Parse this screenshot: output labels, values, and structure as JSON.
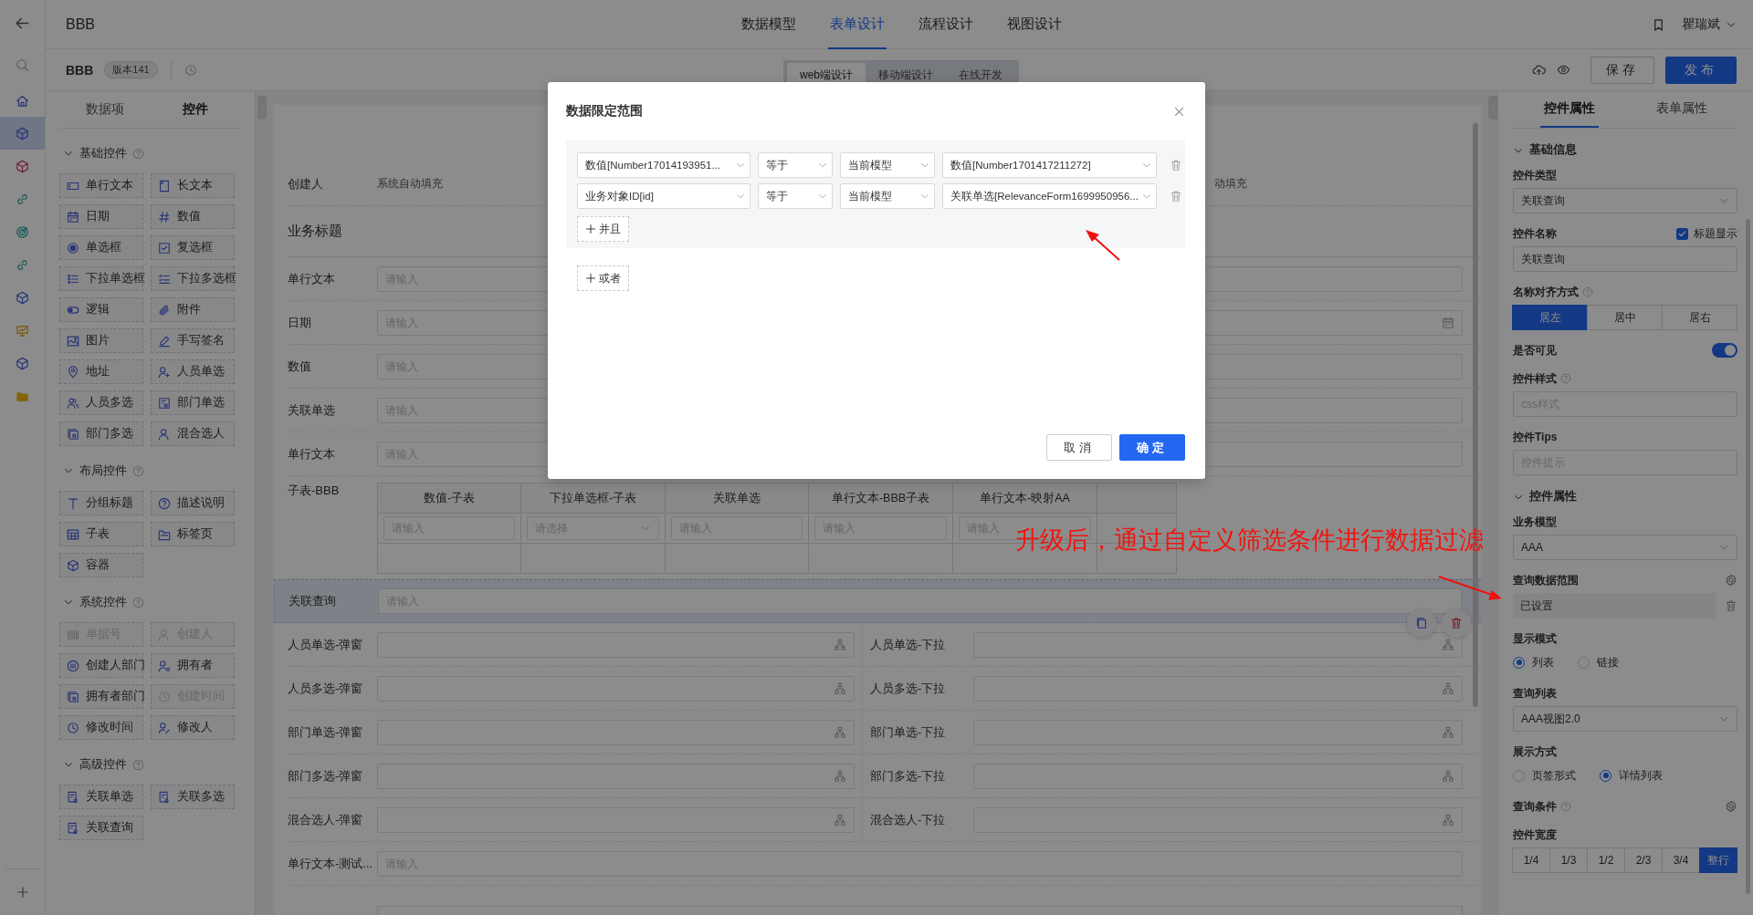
{
  "nav": {
    "items": [
      {
        "selected": false
      },
      {
        "selected": true
      },
      {
        "selected": false
      },
      {
        "selected": false
      },
      {
        "selected": false
      },
      {
        "selected": false
      },
      {
        "selected": false
      },
      {
        "selected": false
      },
      {
        "selected": false
      },
      {
        "selected": false
      }
    ]
  },
  "header": {
    "app_title": "BBB",
    "tabs": [
      {
        "label": "数据模型",
        "selected": false
      },
      {
        "label": "表单设计",
        "selected": true
      },
      {
        "label": "流程设计",
        "selected": false
      },
      {
        "label": "视图设计",
        "selected": false
      }
    ],
    "user": "瞿瑞斌"
  },
  "toolbar": {
    "form_name": "BBB",
    "version": "版本141",
    "modes": [
      {
        "label": "web端设计",
        "selected": true
      },
      {
        "label": "移动端设计",
        "selected": false
      },
      {
        "label": "在线开发",
        "selected": false
      }
    ],
    "buttons": [
      {
        "label": "保存",
        "kind": "default"
      },
      {
        "label": "发布",
        "kind": "primary"
      }
    ]
  },
  "palette": {
    "tabs": [
      {
        "label": "数据项",
        "selected": false
      },
      {
        "label": "控件",
        "selected": true
      }
    ],
    "groups": [
      {
        "title": "基础控件",
        "expanded": true,
        "items": [
          {
            "label": "单行文本",
            "disabled": false
          },
          {
            "label": "长文本",
            "disabled": false
          },
          {
            "label": "日期",
            "disabled": false
          },
          {
            "label": "数值",
            "disabled": false
          },
          {
            "label": "单选框",
            "disabled": false
          },
          {
            "label": "复选框",
            "disabled": false
          },
          {
            "label": "下拉单选框",
            "disabled": false
          },
          {
            "label": "下拉多选框",
            "disabled": false
          },
          {
            "label": "逻辑",
            "disabled": false
          },
          {
            "label": "附件",
            "disabled": false
          },
          {
            "label": "图片",
            "disabled": false
          },
          {
            "label": "手写签名",
            "disabled": false
          },
          {
            "label": "地址",
            "disabled": false
          },
          {
            "label": "人员单选",
            "disabled": false
          },
          {
            "label": "人员多选",
            "disabled": false
          },
          {
            "label": "部门单选",
            "disabled": false
          },
          {
            "label": "部门多选",
            "disabled": false
          },
          {
            "label": "混合选人",
            "disabled": false
          }
        ]
      },
      {
        "title": "布局控件",
        "expanded": true,
        "items": [
          {
            "label": "分组标题",
            "disabled": false
          },
          {
            "label": "描述说明",
            "disabled": false
          },
          {
            "label": "子表",
            "disabled": false
          },
          {
            "label": "标签页",
            "disabled": false
          },
          {
            "label": "容器",
            "disabled": false
          }
        ]
      },
      {
        "title": "系统控件",
        "expanded": true,
        "items": [
          {
            "label": "单据号",
            "disabled": true
          },
          {
            "label": "创建人",
            "disabled": true
          },
          {
            "label": "创建人部门",
            "disabled": false
          },
          {
            "label": "拥有者",
            "disabled": false
          },
          {
            "label": "拥有者部门",
            "disabled": false
          },
          {
            "label": "创建时间",
            "disabled": true
          },
          {
            "label": "修改时间",
            "disabled": false
          },
          {
            "label": "修改人",
            "disabled": false
          }
        ]
      },
      {
        "title": "高级控件",
        "expanded": true,
        "items": [
          {
            "label": "关联单选",
            "disabled": false
          },
          {
            "label": "关联多选",
            "disabled": false
          },
          {
            "label": "关联查询",
            "disabled": false
          }
        ]
      }
    ]
  },
  "form": {
    "rows": [
      {
        "kind": "auto_pair",
        "selected": false,
        "cells": [
          {
            "label": "创建人",
            "value": "系统自动填充"
          },
          {
            "value": "动填充"
          }
        ]
      },
      {
        "kind": "section",
        "selected": false,
        "title": "业务标题"
      },
      {
        "kind": "field",
        "selected": false,
        "label": "单行文本",
        "placeholder": "请输入"
      },
      {
        "kind": "date",
        "selected": false,
        "label": "日期",
        "placeholder": "请输入"
      },
      {
        "kind": "field",
        "selected": false,
        "label": "数值",
        "placeholder": "请输入"
      },
      {
        "kind": "field",
        "selected": false,
        "label": "关联单选",
        "placeholder": "请输入"
      },
      {
        "kind": "field",
        "selected": false,
        "label": "单行文本",
        "placeholder": "请输入"
      },
      {
        "kind": "subtable",
        "selected": false,
        "label": "子表-BBB",
        "columns": [
          {
            "header": "数值-子表",
            "kind": "input",
            "placeholder": "请输入"
          },
          {
            "header": "下拉单选框-子表",
            "kind": "select",
            "placeholder": "请选择"
          },
          {
            "header": "关联单选",
            "kind": "input",
            "placeholder": "请输入"
          },
          {
            "header": "单行文本-BBB子表",
            "kind": "input",
            "placeholder": "请输入"
          },
          {
            "header": "单行文本-映射AA",
            "kind": "input",
            "placeholder": "请输入"
          }
        ]
      },
      {
        "kind": "field",
        "selected": true,
        "label": "关联查询",
        "placeholder": "请输入"
      },
      {
        "kind": "picker_pair",
        "selected": false,
        "cells": [
          {
            "label": "人员单选-弹窗"
          },
          {
            "label": "人员单选-下拉"
          }
        ]
      },
      {
        "kind": "picker_pair",
        "selected": false,
        "cells": [
          {
            "label": "人员多选-弹窗"
          },
          {
            "label": "人员多选-下拉"
          }
        ]
      },
      {
        "kind": "picker_pair",
        "selected": false,
        "cells": [
          {
            "label": "部门单选-弹窗"
          },
          {
            "label": "部门单选-下拉"
          }
        ]
      },
      {
        "kind": "picker_pair",
        "selected": false,
        "cells": [
          {
            "label": "部门多选-弹窗"
          },
          {
            "label": "部门多选-下拉"
          }
        ]
      },
      {
        "kind": "picker_pair",
        "selected": false,
        "cells": [
          {
            "label": "混合选人-弹窗"
          },
          {
            "label": "混合选人-下拉"
          }
        ]
      },
      {
        "kind": "field",
        "selected": false,
        "label": "单行文本-测试...",
        "placeholder": "请输入"
      }
    ]
  },
  "properties": {
    "tabs": [
      {
        "label": "控件属性",
        "selected": true
      },
      {
        "label": "表单属性",
        "selected": false
      }
    ],
    "sections": [
      {
        "title": "基础信息",
        "expanded": true,
        "fields": [
          {
            "kind": "select",
            "label": "控件类型",
            "help": false,
            "value": "关联查询"
          },
          {
            "kind": "input",
            "label": "控件名称",
            "help": false,
            "value": "关联查询",
            "check": {
              "label": "标题显示",
              "checked": true
            }
          },
          {
            "kind": "segmented",
            "label": "名称对齐方式",
            "help": true,
            "options": [
              {
                "label": "居左",
                "selected": true
              },
              {
                "label": "居中",
                "selected": false
              },
              {
                "label": "居右",
                "selected": false
              }
            ]
          },
          {
            "kind": "switch",
            "label": "是否可见",
            "help": false,
            "on": true
          },
          {
            "kind": "input",
            "label": "控件样式",
            "help": true,
            "placeholder": "css样式"
          },
          {
            "kind": "input",
            "label": "控件Tips",
            "help": false,
            "placeholder": "控件提示"
          }
        ]
      },
      {
        "title": "控件属性",
        "expanded": true,
        "fields": [
          {
            "kind": "select",
            "label": "业务模型",
            "help": false,
            "value": "AAA"
          },
          {
            "kind": "range",
            "label": "查询数据范围",
            "help": false,
            "value": "已设置"
          },
          {
            "kind": "radio",
            "label": "显示模式",
            "help": false,
            "options": [
              {
                "label": "列表",
                "selected": true
              },
              {
                "label": "链接",
                "selected": false
              }
            ]
          },
          {
            "kind": "select",
            "label": "查询列表",
            "help": false,
            "value": "AAA视图2.0"
          },
          {
            "kind": "radio",
            "label": "展示方式",
            "help": false,
            "options": [
              {
                "label": "页签形式",
                "selected": false
              },
              {
                "label": "详情列表",
                "selected": true
              }
            ]
          },
          {
            "kind": "settings",
            "label": "查询条件",
            "help": true
          },
          {
            "kind": "segmented",
            "label": "控件宽度",
            "help": false,
            "options": [
              {
                "label": "1/4",
                "selected": false
              },
              {
                "label": "1/3",
                "selected": false
              },
              {
                "label": "1/2",
                "selected": false
              },
              {
                "label": "2/3",
                "selected": false
              },
              {
                "label": "3/4",
                "selected": false
              },
              {
                "label": "整行",
                "selected": true
              }
            ]
          }
        ]
      }
    ]
  },
  "dialog": {
    "title": "数据限定范围",
    "conditions": [
      {
        "field": "数值[Number17014193951...",
        "operator": "等于",
        "source": "当前模型",
        "value": "数值[Number1701417211272]"
      },
      {
        "field": "业务对象ID[id]",
        "operator": "等于",
        "source": "当前模型",
        "value": "关联单选[RelevanceForm1699950956..."
      }
    ],
    "and_button": "并且",
    "or_button": "或者",
    "buttons": [
      {
        "label": "取消",
        "kind": "default"
      },
      {
        "label": "确定",
        "kind": "primary"
      }
    ]
  },
  "annotation": {
    "text": "升级后，通过自定义筛选条件进行数据过滤"
  }
}
